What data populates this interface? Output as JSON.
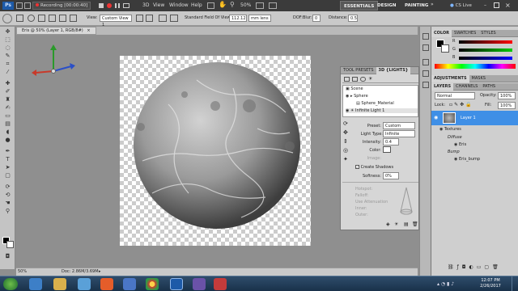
{
  "appbar": {
    "ps_logo": "Ps",
    "recording": "Recording [00:00:40]",
    "menus": [
      "3D",
      "View",
      "Window",
      "Help"
    ],
    "zoom": "50%",
    "workspaces": [
      "ESSENTIALS",
      "DESIGN",
      "PAINTING"
    ],
    "cs_live": "CS Live"
  },
  "options": {
    "view_label": "View:",
    "view_value": "Custom View 1",
    "fov_label": "Standard Field Of View:",
    "fov_value": "112.12",
    "fov_unit": "mm lens",
    "dof_label": "DOF:",
    "blur_label": "Blur:",
    "blur_value": "0",
    "distance_label": "Distance:",
    "distance_value": "0.5"
  },
  "document": {
    "tab_title": "Eris @ 50% (Layer 1, RGB/8#)",
    "close": "×"
  },
  "status": {
    "zoom": "50%",
    "doc": "Doc: 2.86M/3.69M"
  },
  "panel3d": {
    "tabs": [
      "TOOL PRESETS",
      "3D {LIGHTS}"
    ],
    "scene_items": [
      "Scene",
      "Sphere",
      "Sphere_Material",
      "Infinite Light 1"
    ],
    "preset_label": "Preset:",
    "preset_value": "Custom",
    "light_type_label": "Light Type:",
    "light_type_value": "Infinite",
    "intensity_label": "Intensity:",
    "intensity_value": "0.4",
    "color_label": "Color:",
    "image_label": "Image:",
    "create_shadows": "Create Shadows",
    "softness_label": "Softness:",
    "softness_value": "0%",
    "hotspot_label": "Hotspot:",
    "falloff_label": "Falloff:",
    "use_attenuation": "Use Attenuation",
    "inner_label": "Inner:",
    "outer_label": "Outer:"
  },
  "color_panel": {
    "tabs": [
      "COLOR",
      "SWATCHES",
      "STYLES"
    ],
    "channels": [
      "R",
      "G",
      "B"
    ],
    "values": [
      "",
      "",
      ""
    ]
  },
  "adjustments_tabs": [
    "ADJUSTMENTS",
    "MASKS"
  ],
  "layers": {
    "tabs": [
      "LAYERS",
      "CHANNELS",
      "PATHS"
    ],
    "blend_mode": "Normal",
    "opacity_label": "Opacity:",
    "opacity_value": "100%",
    "lock_label": "Lock:",
    "fill_label": "Fill:",
    "fill_value": "100%",
    "layer_name": "Layer 1",
    "sub": [
      "Textures",
      "Diffuse",
      "Eris",
      "Bump",
      "Eris_bump"
    ]
  },
  "taskbar": {
    "time": "12:07 PM",
    "date": "2/26/2017"
  },
  "colors": {
    "accent": "#3f8fe6",
    "appbar": "#3b3b3b",
    "panel": "#d6d6d6",
    "taskbar": "#1f3a57"
  }
}
